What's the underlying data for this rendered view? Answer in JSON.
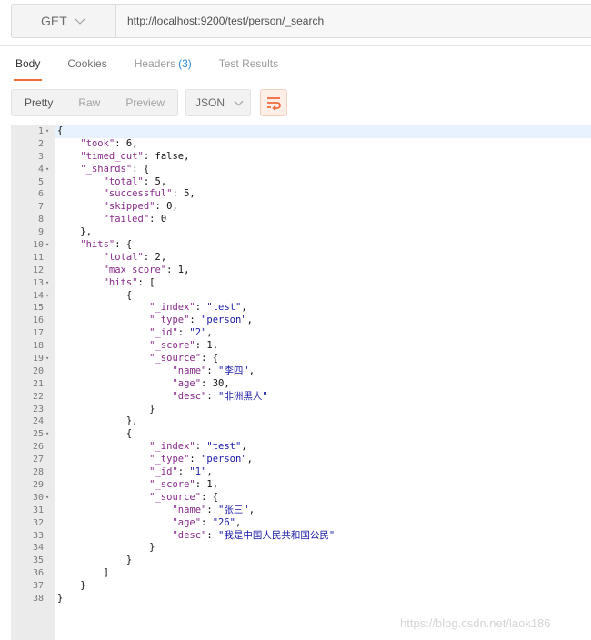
{
  "request": {
    "method": "GET",
    "url": "http://localhost:9200/test/person/_search"
  },
  "tabs": [
    {
      "label": "Body"
    },
    {
      "label": "Cookies"
    },
    {
      "label": "Headers",
      "count": "(3)"
    },
    {
      "label": "Test Results"
    }
  ],
  "format": {
    "options": [
      "Pretty",
      "Raw",
      "Preview"
    ],
    "language": "JSON",
    "wrap_icon": "wrap-lines-icon"
  },
  "colors": {
    "accent": "#f26b3a",
    "key": "#882d8a",
    "string": "#1a1aa6"
  },
  "code_lines": [
    {
      "n": "1",
      "fold": true,
      "t": "{"
    },
    {
      "n": "2",
      "t": "    \"took\": 6,"
    },
    {
      "n": "3",
      "t": "    \"timed_out\": false,"
    },
    {
      "n": "4",
      "fold": true,
      "t": "    \"_shards\": {"
    },
    {
      "n": "5",
      "t": "        \"total\": 5,"
    },
    {
      "n": "6",
      "t": "        \"successful\": 5,"
    },
    {
      "n": "7",
      "t": "        \"skipped\": 0,"
    },
    {
      "n": "8",
      "t": "        \"failed\": 0"
    },
    {
      "n": "9",
      "t": "    },"
    },
    {
      "n": "10",
      "fold": true,
      "t": "    \"hits\": {"
    },
    {
      "n": "11",
      "t": "        \"total\": 2,"
    },
    {
      "n": "12",
      "t": "        \"max_score\": 1,"
    },
    {
      "n": "13",
      "fold": true,
      "t": "        \"hits\": ["
    },
    {
      "n": "14",
      "fold": true,
      "t": "            {"
    },
    {
      "n": "15",
      "t": "                \"_index\": \"test\","
    },
    {
      "n": "16",
      "t": "                \"_type\": \"person\","
    },
    {
      "n": "17",
      "t": "                \"_id\": \"2\","
    },
    {
      "n": "18",
      "t": "                \"_score\": 1,"
    },
    {
      "n": "19",
      "fold": true,
      "t": "                \"_source\": {"
    },
    {
      "n": "20",
      "t": "                    \"name\": \"李四\","
    },
    {
      "n": "21",
      "t": "                    \"age\": 30,"
    },
    {
      "n": "22",
      "t": "                    \"desc\": \"非洲黑人\""
    },
    {
      "n": "23",
      "t": "                }"
    },
    {
      "n": "24",
      "t": "            },"
    },
    {
      "n": "25",
      "fold": true,
      "t": "            {"
    },
    {
      "n": "26",
      "t": "                \"_index\": \"test\","
    },
    {
      "n": "27",
      "t": "                \"_type\": \"person\","
    },
    {
      "n": "28",
      "t": "                \"_id\": \"1\","
    },
    {
      "n": "29",
      "t": "                \"_score\": 1,"
    },
    {
      "n": "30",
      "fold": true,
      "t": "                \"_source\": {"
    },
    {
      "n": "31",
      "t": "                    \"name\": \"张三\","
    },
    {
      "n": "32",
      "t": "                    \"age\": \"26\","
    },
    {
      "n": "33",
      "t": "                    \"desc\": \"我是中国人民共和国公民\""
    },
    {
      "n": "34",
      "t": "                }"
    },
    {
      "n": "35",
      "t": "            }"
    },
    {
      "n": "36",
      "t": "        ]"
    },
    {
      "n": "37",
      "t": "    }"
    },
    {
      "n": "38",
      "t": "}"
    }
  ],
  "watermark": "https://blog.csdn.net/laok186"
}
